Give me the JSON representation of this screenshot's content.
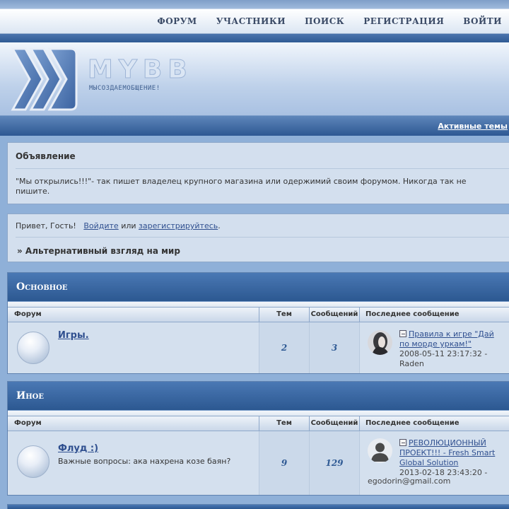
{
  "nav": {
    "items": [
      "ФОРУМ",
      "УЧАСТНИКИ",
      "ПОИСК",
      "РЕГИСТРАЦИЯ",
      "ВОЙТИ"
    ]
  },
  "header": {
    "logo_text": "MYBB",
    "slogan": "МЫСОЗДАЕМОБЩЕНИЕ!"
  },
  "active_topics_link": "Активные темы",
  "announcement": {
    "title": "Объявление",
    "text": "\"Мы открылись!!!\"- так пишет владелец крупного магазина или одержимий своим форумом. Никогда так не пишите."
  },
  "welcome": {
    "greeting": "Привет, Гость!",
    "login_link": "Войдите",
    "or_text": "или",
    "register_link": "зарегистрируйтесь",
    "period": ".",
    "tagline": "» Альтернативный взгляд на мир"
  },
  "columns": {
    "forum": "Форум",
    "topics": "Тем",
    "posts": "Сообщений",
    "last_post": "Последнее сообщение"
  },
  "categories": [
    {
      "name": "Основное",
      "forums": [
        {
          "name": "Игры.",
          "description": "",
          "topics": "2",
          "posts": "3",
          "last_topic": "Правила к игре \"Дай по морде уркам!\"",
          "last_date": "2008-05-11 23:17:32 -",
          "last_author": "Raden"
        }
      ]
    },
    {
      "name": "Иное",
      "forums": [
        {
          "name": "Флуд :)",
          "description": "Важные вопросы: ака нахрена козе баян?",
          "topics": "9",
          "posts": "129",
          "last_topic": "РЕВОЛЮЦИОННЫЙ ПРОЕКТ!!! - Fresh Smart Global Solution",
          "last_date": "2013-02-18 23:43:20 -",
          "last_author": "egodorin@gmail.com"
        }
      ]
    }
  ],
  "colors": {
    "accent": "#2c5891",
    "link": "#2f4f8f",
    "panel": "#d3dfee"
  }
}
